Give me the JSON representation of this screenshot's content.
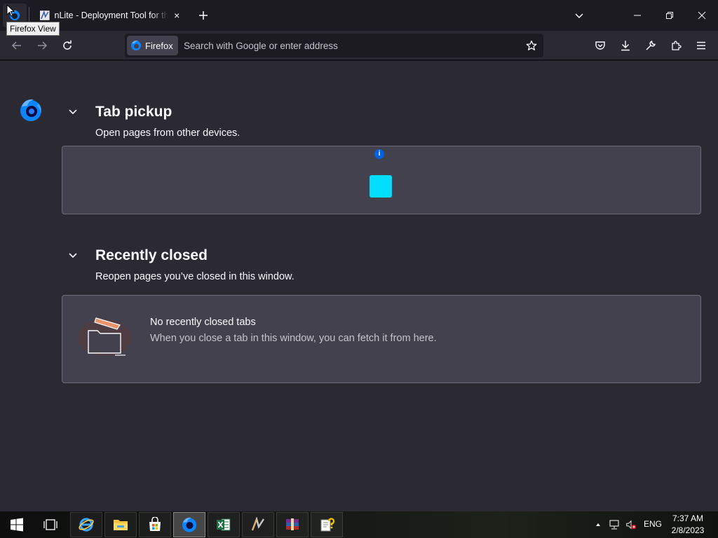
{
  "titlebar": {
    "firefox_view_tooltip": "Firefox View",
    "tab": {
      "title": "nLite - Deployment Tool for the",
      "close": "×"
    },
    "new_tab": "+",
    "list_all_tabs": "chevron-down-icon",
    "window_controls": {
      "minimize": "minimize-icon",
      "restore": "restore-icon",
      "close": "close-icon"
    }
  },
  "navbar": {
    "back": "back-arrow-icon",
    "forward": "forward-arrow-icon",
    "reload": "reload-icon",
    "identity_label": "Firefox",
    "url_placeholder": "Search with Google or enter address",
    "bookmark": "star-icon",
    "toolbar_icons": [
      "pocket-icon",
      "downloads-icon",
      "wrench-icon",
      "extensions-icon",
      "menu-icon"
    ]
  },
  "firefox_view": {
    "tab_pickup": {
      "title": "Tab pickup",
      "description": "Open pages from other devices."
    },
    "recently_closed": {
      "title": "Recently closed",
      "description": "Reopen pages you’ve closed in this window.",
      "empty_title": "No recently closed tabs",
      "empty_description": "When you close a tab in this window, you can fetch it from here."
    }
  },
  "taskbar": {
    "apps": [
      "internet-explorer-icon",
      "file-explorer-icon",
      "store-icon",
      "firefox-icon",
      "excel-icon",
      "nlite-icon",
      "winrar-icon",
      "help-icon"
    ],
    "language": "ENG",
    "time": "7:37 AM",
    "date": "2/8/2023"
  },
  "colors": {
    "accent": "#00ddff",
    "content_bg": "#2b2a33",
    "card_bg": "#42414d"
  }
}
